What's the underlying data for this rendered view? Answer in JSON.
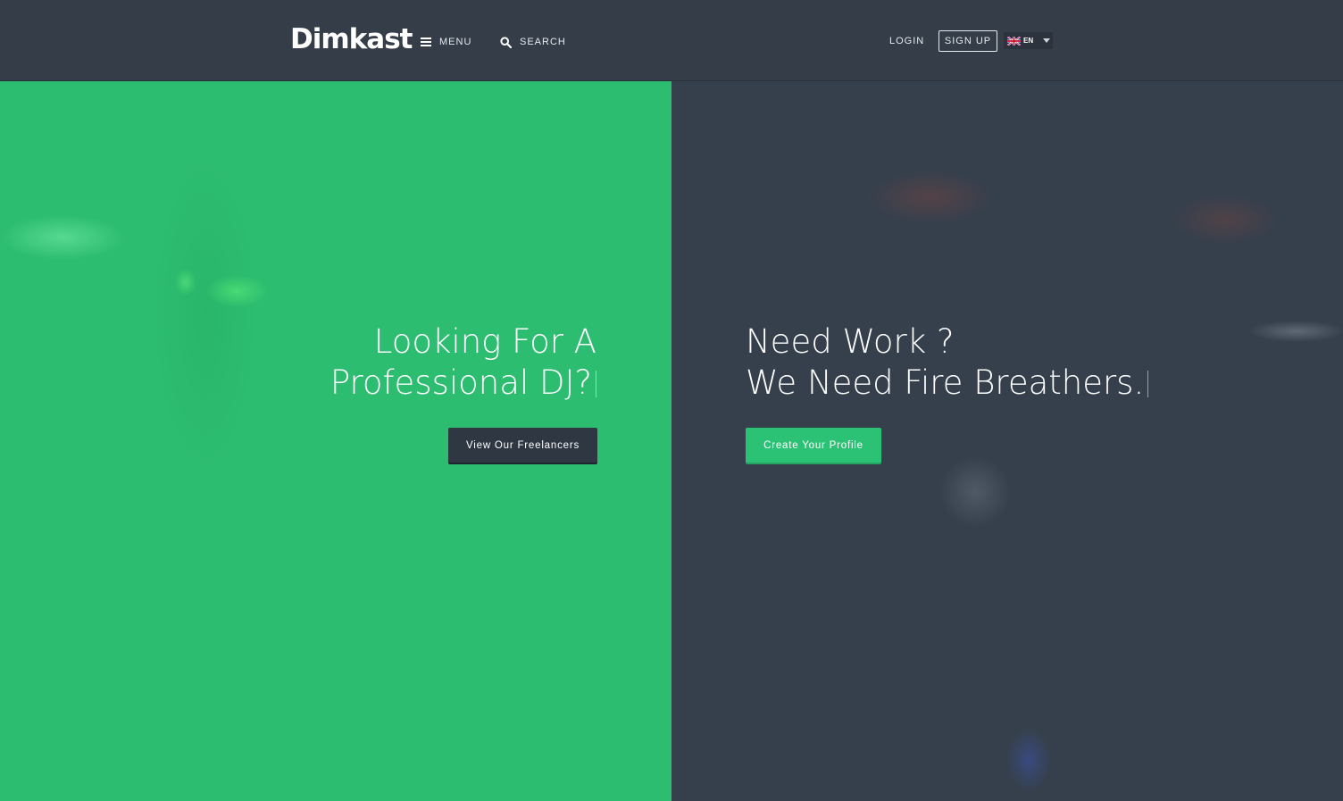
{
  "header": {
    "logo": "Dimkast",
    "menu_label": "MENU",
    "search_label": "SEARCH",
    "login_label": "LOGIN",
    "signup_label": "SIGN UP",
    "language": {
      "code": "EN",
      "flag_icon": "uk-flag-icon"
    }
  },
  "hero_left": {
    "heading_line1": "Looking For A",
    "heading_line2": "Professional DJ?",
    "button_label": "View Our Freelancers",
    "background_color": "#2dbd70"
  },
  "hero_right": {
    "heading_line1": "Need Work ?",
    "heading_line2": "We Need Fire Breathers.",
    "button_label": "Create Your Profile",
    "background_color": "#36404d"
  },
  "colors": {
    "header_bg": "#353d48",
    "accent_green": "#2bc275",
    "dark_button": "#2f3743"
  }
}
